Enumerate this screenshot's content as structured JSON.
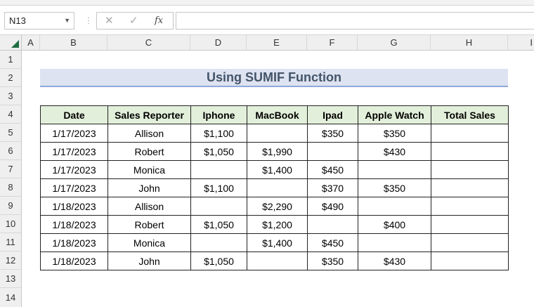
{
  "formula_bar": {
    "name_box": "N13",
    "cancel_icon": "✕",
    "enter_icon": "✓",
    "fx_label": "fx",
    "formula": ""
  },
  "columns": [
    "A",
    "B",
    "C",
    "D",
    "E",
    "F",
    "G",
    "H",
    "I"
  ],
  "rows": [
    "1",
    "2",
    "3",
    "4",
    "5",
    "6",
    "7",
    "8",
    "9",
    "10",
    "11",
    "12",
    "13",
    "14"
  ],
  "title": "Using SUMIF Function",
  "table": {
    "headers": [
      "Date",
      "Sales Reporter",
      "Iphone",
      "MacBook",
      "Ipad",
      "Apple Watch",
      "Total Sales"
    ],
    "rows": [
      [
        "1/17/2023",
        "Allison",
        "$1,100",
        "",
        "$350",
        "$350",
        ""
      ],
      [
        "1/17/2023",
        "Robert",
        "$1,050",
        "$1,990",
        "",
        "$430",
        ""
      ],
      [
        "1/17/2023",
        "Monica",
        "",
        "$1,400",
        "$450",
        "",
        ""
      ],
      [
        "1/17/2023",
        "John",
        "$1,100",
        "",
        "$370",
        "$350",
        ""
      ],
      [
        "1/18/2023",
        "Allison",
        "",
        "$2,290",
        "$490",
        "",
        ""
      ],
      [
        "1/18/2023",
        "Robert",
        "$1,050",
        "$1,200",
        "",
        "$400",
        ""
      ],
      [
        "1/18/2023",
        "Monica",
        "",
        "$1,400",
        "$450",
        "",
        ""
      ],
      [
        "1/18/2023",
        "John",
        "$1,050",
        "",
        "$350",
        "$430",
        ""
      ]
    ]
  },
  "colors": {
    "header_fill": "#e2efda",
    "title_fill": "#dde3f0",
    "title_text": "#44546a",
    "title_border": "#8ea9db",
    "select_all_marker": "#1f6e43"
  }
}
